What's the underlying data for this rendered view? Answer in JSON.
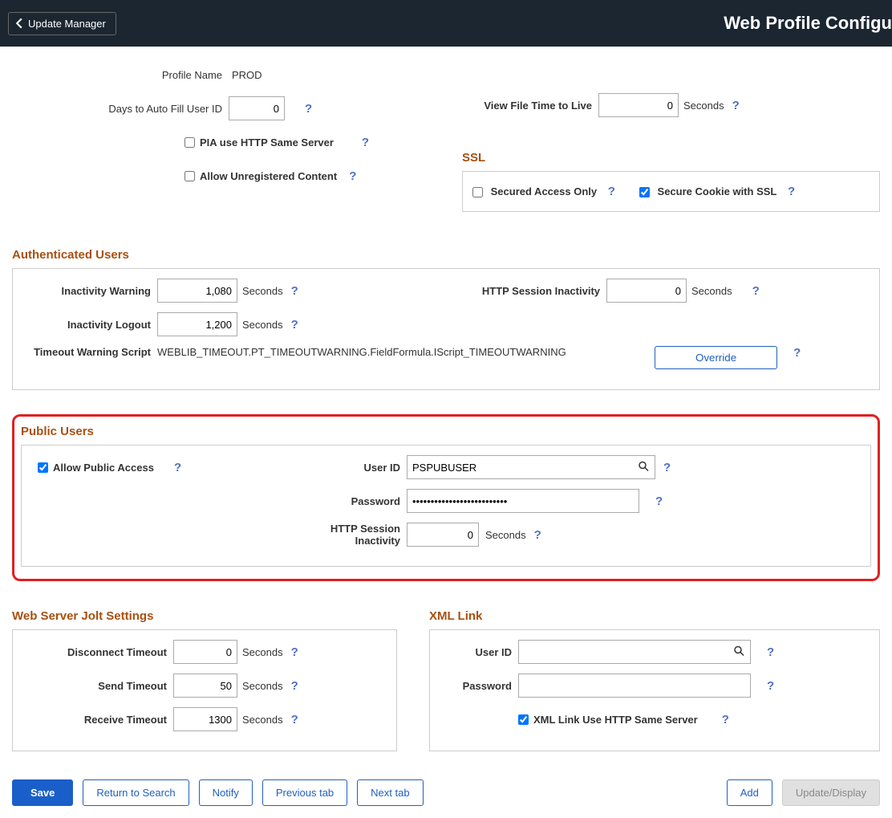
{
  "banner": {
    "back_label": "Update Manager",
    "title": "Web Profile Configu"
  },
  "profile": {
    "name_label": "Profile Name",
    "name_value": "PROD",
    "days_autofill_label": "Days to Auto Fill User ID",
    "days_autofill_value": "0",
    "pia_same_server_label": "PIA use HTTP Same Server",
    "allow_unregistered_label": "Allow Unregistered Content",
    "view_file_ttl_label": "View File Time to Live",
    "view_file_ttl_value": "0",
    "seconds_label": "Seconds"
  },
  "ssl": {
    "title": "SSL",
    "secured_only_label": "Secured Access Only",
    "secure_cookie_label": "Secure Cookie with SSL"
  },
  "auth": {
    "title": "Authenticated Users",
    "inactivity_warning_label": "Inactivity Warning",
    "inactivity_warning_value": "1,080",
    "inactivity_logout_label": "Inactivity Logout",
    "inactivity_logout_value": "1,200",
    "http_inactivity_label": "HTTP Session Inactivity",
    "http_inactivity_value": "0",
    "seconds_label": "Seconds",
    "timeout_script_label": "Timeout Warning Script",
    "timeout_script_value": "WEBLIB_TIMEOUT.PT_TIMEOUTWARNING.FieldFormula.IScript_TIMEOUTWARNING",
    "override_label": "Override"
  },
  "public": {
    "title": "Public Users",
    "allow_access_label": "Allow Public Access",
    "user_id_label": "User ID",
    "user_id_value": "PSPUBUSER",
    "password_label": "Password",
    "password_value": "••••••••••••••••••••••••••",
    "http_inactivity_label": "HTTP Session Inactivity",
    "http_inactivity_value": "0",
    "seconds_label": "Seconds"
  },
  "jolt": {
    "title": "Web Server Jolt Settings",
    "disconnect_label": "Disconnect Timeout",
    "disconnect_value": "0",
    "send_label": "Send Timeout",
    "send_value": "50",
    "receive_label": "Receive Timeout",
    "receive_value": "1300",
    "seconds_label": "Seconds"
  },
  "xml": {
    "title": "XML Link",
    "user_id_label": "User ID",
    "password_label": "Password",
    "same_server_label": "XML Link Use HTTP Same Server"
  },
  "footer": {
    "save": "Save",
    "return": "Return to Search",
    "notify": "Notify",
    "prev_tab": "Previous tab",
    "next_tab": "Next tab",
    "add": "Add",
    "update": "Update/Display"
  }
}
